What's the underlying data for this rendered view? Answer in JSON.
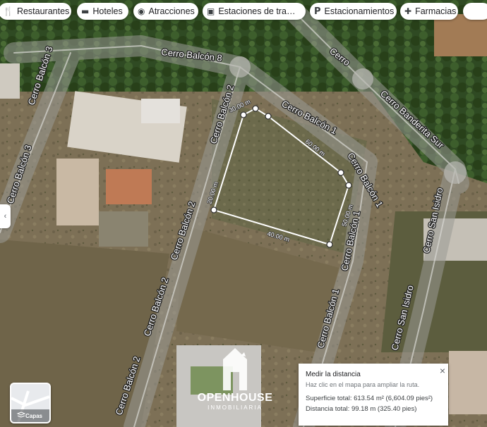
{
  "chips": [
    {
      "icon": "restaurant-icon",
      "glyph": "🍴",
      "label": "Restaurantes"
    },
    {
      "icon": "bed-icon",
      "glyph": "▬",
      "label": "Hoteles"
    },
    {
      "icon": "camera-icon",
      "glyph": "◉",
      "label": "Atracciones"
    },
    {
      "icon": "bus-icon",
      "glyph": "▣",
      "label": "Estaciones de transporte"
    },
    {
      "icon": "parking-icon",
      "glyph": "P",
      "label": "Estacionamientos"
    },
    {
      "icon": "pharmacy-icon",
      "glyph": "✚",
      "label": "Farmacias"
    },
    {
      "icon": "more-icon",
      "glyph": "",
      "label": ""
    }
  ],
  "streets": [
    {
      "name": "Cerro Balcón 8"
    },
    {
      "name": "Cerro Balcón 3"
    },
    {
      "name": "Cerro Balcón 3"
    },
    {
      "name": "Cerro Balcón 2"
    },
    {
      "name": "Cerro Balcón 2"
    },
    {
      "name": "Cerro Balcón 2"
    },
    {
      "name": "Cerro Balcón 2"
    },
    {
      "name": "Cerro Balcón 1"
    },
    {
      "name": "Cerro Balcón 1"
    },
    {
      "name": "Cerro Balcón 1"
    },
    {
      "name": "Cerro Balcón 1"
    },
    {
      "name": "Cerro"
    },
    {
      "name": "Cerro Banderita Sur"
    },
    {
      "name": "Cerro San Isidro"
    },
    {
      "name": "Cerro San Isidro"
    }
  ],
  "measurement": {
    "segments": [
      "30.00 m",
      "60.00 m",
      "50.00 m",
      "40.00 m",
      "20.00 m"
    ],
    "panel": {
      "title": "Medir la distancia",
      "hint": "Haz clic en el mapa para ampliar la ruta.",
      "area": "Superficie total: 613.54 m² (6,604.09 pies²)",
      "distance": "Distancia total: 99.18 m (325.40 pies)"
    }
  },
  "logo": {
    "name": "OPENHOUSE",
    "sub": "INMOBILIARIA"
  },
  "layers": {
    "label": "Capas"
  },
  "side_tab": {
    "glyph": "‹"
  },
  "close": {
    "glyph": "×"
  }
}
